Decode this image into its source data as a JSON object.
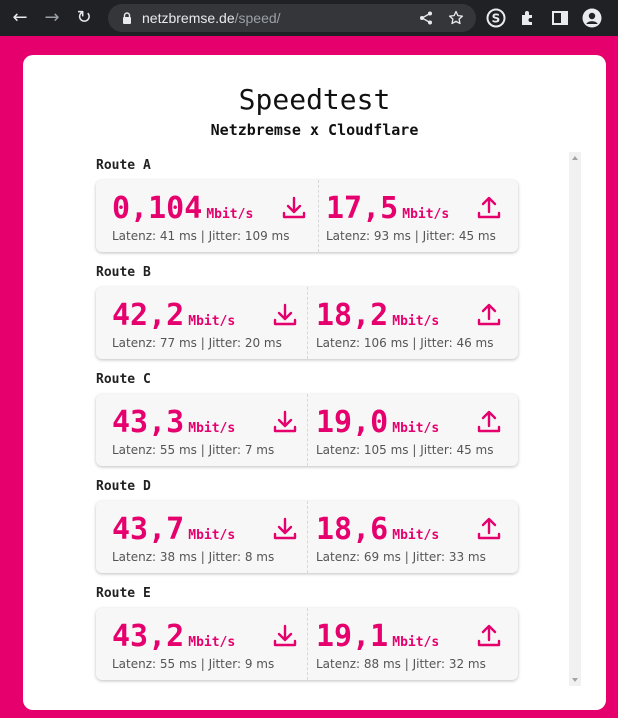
{
  "browser": {
    "url_host": "netzbremse.de",
    "url_path": "/speed/"
  },
  "page": {
    "title": "Speedtest",
    "subtitle": "Netzbremse x Cloudflare"
  },
  "colors": {
    "accent": "#e5006e",
    "chrome": "#202124"
  },
  "routes": [
    {
      "label": "Route A",
      "download": {
        "value": "0,104",
        "unit": "Mbit/s",
        "meta": "Latenz: 41 ms | Jitter: 109 ms"
      },
      "upload": {
        "value": "17,5",
        "unit": "Mbit/s",
        "meta": "Latenz: 93 ms | Jitter: 45 ms"
      }
    },
    {
      "label": "Route B",
      "download": {
        "value": "42,2",
        "unit": "Mbit/s",
        "meta": "Latenz: 77 ms | Jitter: 20 ms"
      },
      "upload": {
        "value": "18,2",
        "unit": "Mbit/s",
        "meta": "Latenz: 106 ms | Jitter: 46 ms"
      }
    },
    {
      "label": "Route C",
      "download": {
        "value": "43,3",
        "unit": "Mbit/s",
        "meta": "Latenz: 55 ms | Jitter: 7 ms"
      },
      "upload": {
        "value": "19,0",
        "unit": "Mbit/s",
        "meta": "Latenz: 105 ms | Jitter: 45 ms"
      }
    },
    {
      "label": "Route D",
      "download": {
        "value": "43,7",
        "unit": "Mbit/s",
        "meta": "Latenz: 38 ms | Jitter: 8 ms"
      },
      "upload": {
        "value": "18,6",
        "unit": "Mbit/s",
        "meta": "Latenz: 69 ms | Jitter: 33 ms"
      }
    },
    {
      "label": "Route E",
      "download": {
        "value": "43,2",
        "unit": "Mbit/s",
        "meta": "Latenz: 55 ms | Jitter: 9 ms"
      },
      "upload": {
        "value": "19,1",
        "unit": "Mbit/s",
        "meta": "Latenz: 88 ms | Jitter: 32 ms"
      }
    }
  ]
}
